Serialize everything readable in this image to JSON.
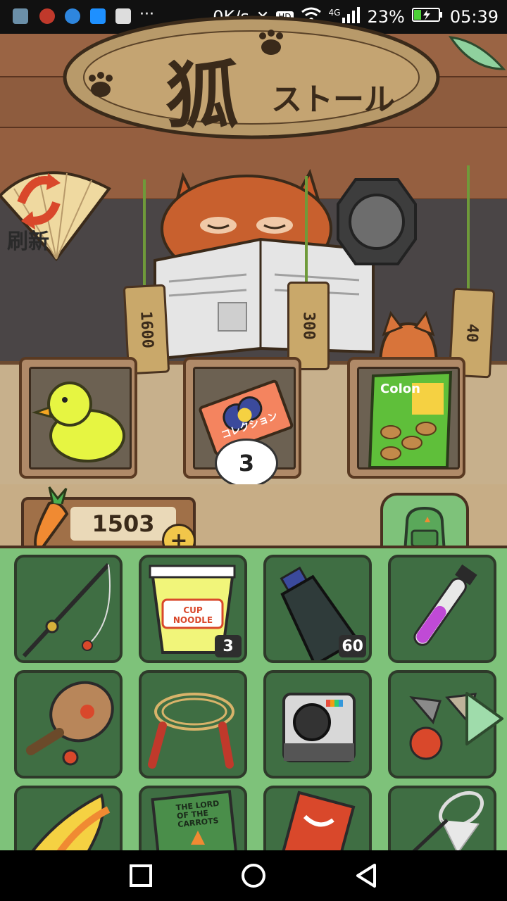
{
  "status_bar": {
    "net_speed": "0K/s",
    "hd": "HD",
    "network": "4G",
    "battery": "23%",
    "time": "05:39",
    "more": "···"
  },
  "shop": {
    "sign_kanji": "狐",
    "sign_kana": "ストール",
    "refresh_label": "刷新",
    "prices": [
      "1600",
      "300",
      "40"
    ],
    "items": [
      {
        "name": "duck-toy"
      },
      {
        "name": "collection-ticket",
        "label": "コレクション",
        "quantity": "3"
      },
      {
        "name": "colon-snack",
        "label": "Colon"
      }
    ]
  },
  "currency": {
    "carrots": "1503",
    "add": "+"
  },
  "inventory": {
    "row1": [
      {
        "name": "fishing-rod"
      },
      {
        "name": "cup-noodle",
        "label": "CUP NOODLE",
        "count": "3"
      },
      {
        "name": "water-bottle",
        "count": "60"
      },
      {
        "name": "potion-vial"
      }
    ],
    "row2": [
      {
        "name": "paddle-racket"
      },
      {
        "name": "jump-rope"
      },
      {
        "name": "instant-camera"
      },
      {
        "name": "cup-and-ball"
      }
    ],
    "row3": [
      {
        "name": "banana-float"
      },
      {
        "name": "book",
        "label": "THE LORD OF THE CARROTS"
      },
      {
        "name": "card-box"
      },
      {
        "name": "bug-net"
      }
    ]
  },
  "colors": {
    "inventory_bg": "#7ec27a",
    "slot_bg": "#3f6e43",
    "wood": "#8a5a3c",
    "sign": "#c9a86a"
  }
}
